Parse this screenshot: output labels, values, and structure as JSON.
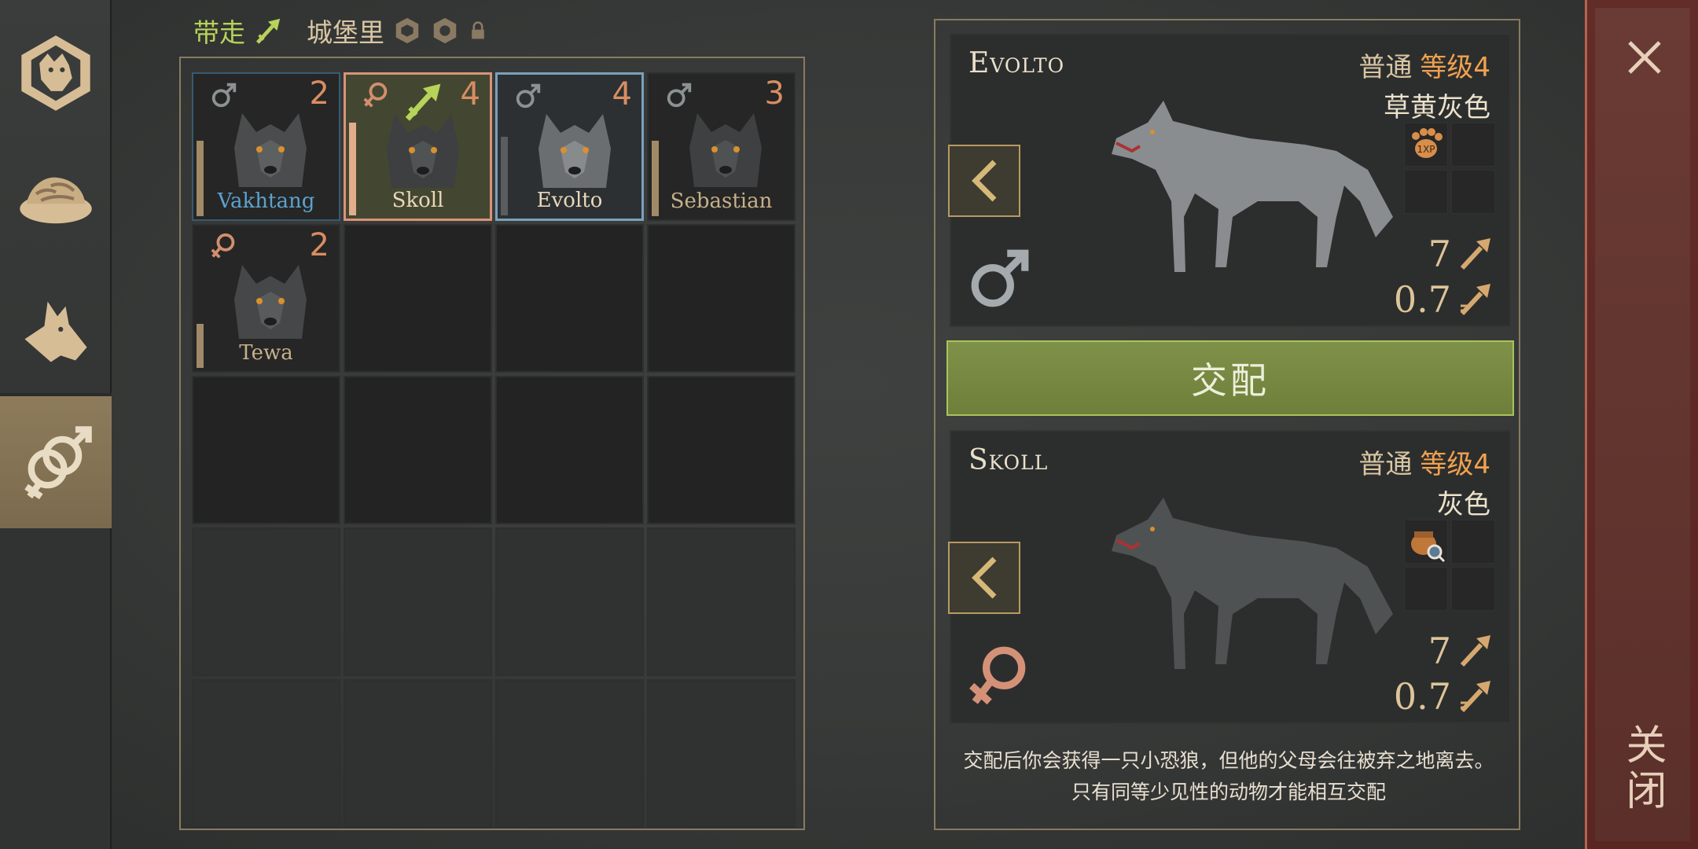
{
  "sidebar": {
    "tabs": [
      {
        "icon": "wolf-emblem-icon",
        "active": false
      },
      {
        "icon": "food-bowl-icon",
        "active": false
      },
      {
        "icon": "wolf-head-icon",
        "active": false
      },
      {
        "icon": "gender-breeding-icon",
        "active": true
      }
    ]
  },
  "filter": {
    "take_label": "带走",
    "castle_label": "城堡里"
  },
  "wolves": [
    {
      "name": "Vakhtang",
      "level": "2",
      "sex": "male",
      "state": "outline"
    },
    {
      "name": "Skoll",
      "level": "4",
      "sex": "female",
      "state": "selected-take"
    },
    {
      "name": "Evolto",
      "level": "4",
      "sex": "male",
      "state": "selected"
    },
    {
      "name": "Sebastian",
      "level": "3",
      "sex": "male",
      "state": "normal"
    },
    {
      "name": "Tewa",
      "level": "2",
      "sex": "female",
      "state": "normal"
    }
  ],
  "selected": [
    {
      "name": "Evolto",
      "rarity": "普通",
      "level": "等级4",
      "color": "草黄灰色",
      "sex": "male",
      "stat_attack": "7",
      "stat_speed": "0.7",
      "trait_icon": "xp-paw-icon"
    },
    {
      "name": "Skoll",
      "rarity": "普通",
      "level": "等级4",
      "color": "灰色",
      "sex": "female",
      "stat_attack": "7",
      "stat_speed": "0.7",
      "trait_icon": "meat-pot-icon"
    }
  ],
  "mate_button": "交配",
  "description": "交配后你会获得一只小恐狼，但他的父母会往被弃之地离去。只有同等少见性的动物才能相互交配",
  "close_label": "关闭",
  "colors": {
    "accent_green": "#b7d35a",
    "level_orange": "#f0a150",
    "male_blue": "#5da2cf",
    "close_red": "#5b2f2a"
  }
}
